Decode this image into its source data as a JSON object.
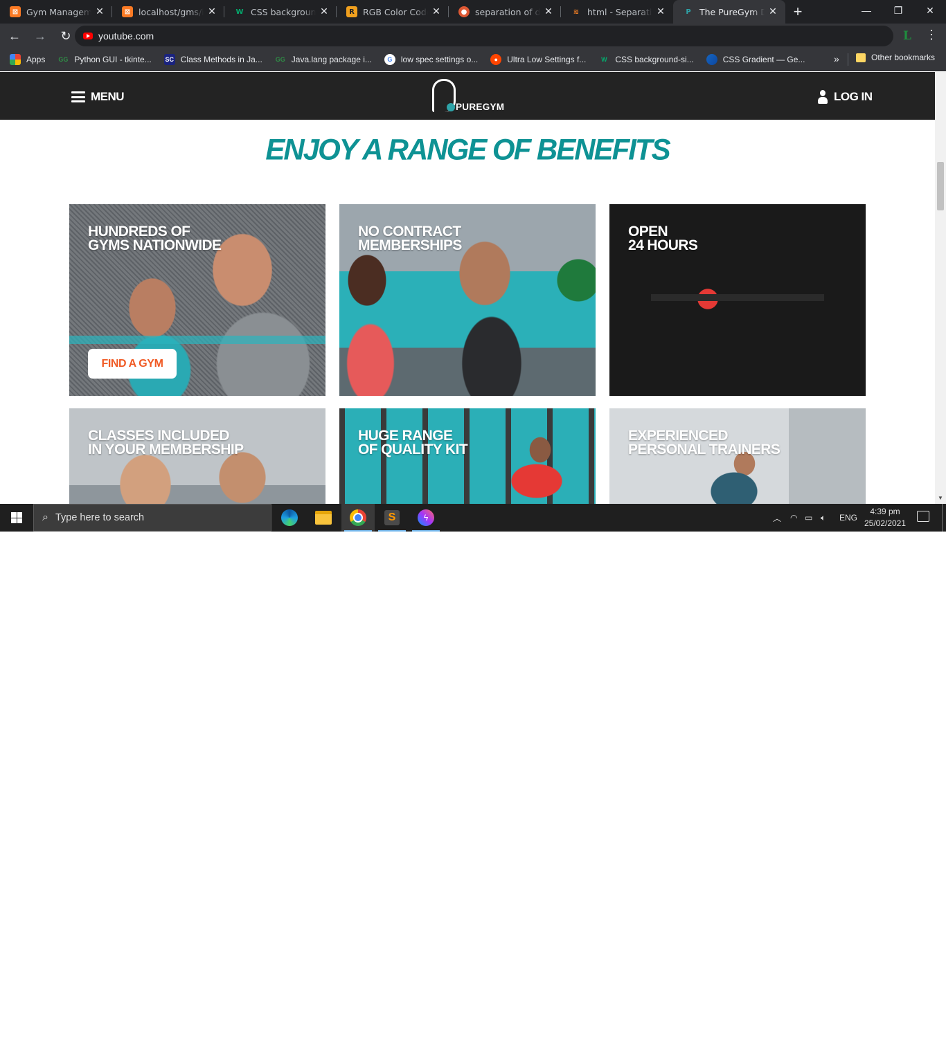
{
  "browser": {
    "tabs": [
      {
        "title": "Gym Management",
        "favicon": "xampp-icon",
        "color": "#fb7a24"
      },
      {
        "title": "localhost/gms/ind",
        "favicon": "xampp-icon",
        "color": "#fb7a24"
      },
      {
        "title": "CSS background-r",
        "favicon": "w3schools-icon",
        "color": "#04aa6d"
      },
      {
        "title": "RGB Color Codes C",
        "favicon": "rapidtables-icon",
        "color": "#f0a01e"
      },
      {
        "title": "separation of div in",
        "favicon": "duckduckgo-icon",
        "color": "#de5833"
      },
      {
        "title": "html - Separating",
        "favicon": "stackoverflow-icon",
        "color": "#f48024"
      },
      {
        "title": "The PureGym Diffe",
        "favicon": "puregym-icon",
        "color": "#2ea3a8"
      }
    ],
    "active_tab": 6,
    "new_tab_label": "+",
    "address": "youtube.com",
    "bookmarks": [
      {
        "label": "Apps",
        "icon": "apps-grid-icon"
      },
      {
        "label": "Python GUI - tkinte...",
        "icon": "geeksforgeeks-icon"
      },
      {
        "label": "Class Methods in Ja...",
        "icon": "studytonight-icon"
      },
      {
        "label": "Java.lang package i...",
        "icon": "geeksforgeeks-icon"
      },
      {
        "label": "low spec settings o...",
        "icon": "google-icon"
      },
      {
        "label": "Ultra Low Settings f...",
        "icon": "reddit-icon"
      },
      {
        "label": "CSS background-si...",
        "icon": "w3schools-icon"
      },
      {
        "label": "CSS Gradient — Ge...",
        "icon": "cssgradient-icon"
      }
    ],
    "bookmarks_overflow": "»",
    "other_bookmarks": "Other bookmarks"
  },
  "site": {
    "menu_label": "MENU",
    "logo_text": "PUREGYM",
    "login_label": "LOG IN",
    "heading": "ENJOY A RANGE OF BENEFITS",
    "cards": [
      {
        "line1": "HUNDREDS OF",
        "line2": "GYMS NATIONWIDE",
        "button": "FIND A GYM"
      },
      {
        "line1": "NO CONTRACT",
        "line2": "MEMBERSHIPS"
      },
      {
        "line1": "OPEN",
        "line2": "24 HOURS"
      },
      {
        "line1": "CLASSES INCLUDED",
        "line2": "IN YOUR MEMBERSHIP"
      },
      {
        "line1": "HUGE RANGE",
        "line2": "OF QUALITY KIT"
      },
      {
        "line1": "EXPERIENCED",
        "line2": "PERSONAL TRAINERS"
      }
    ],
    "accent_color": "#0e9294",
    "button_text_color": "#f05a24"
  },
  "taskbar": {
    "search_placeholder": "Type here to search",
    "apps": [
      "edge-icon",
      "file-explorer-icon",
      "chrome-icon",
      "sublime-text-icon",
      "messenger-icon"
    ],
    "language": "ENG",
    "time": "4:39 pm",
    "date": "25/02/2021"
  }
}
